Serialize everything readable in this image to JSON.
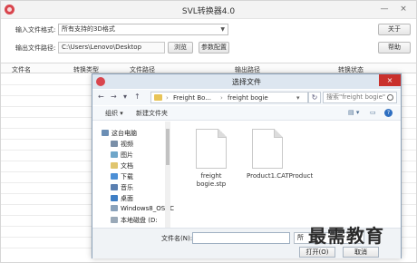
{
  "app": {
    "title": "SVL转换器4.0",
    "minimize": "—",
    "close": "×",
    "input_format_label": "输入文件格式:",
    "input_format_value": "所有支持的3D格式",
    "output_path_label": "输出文件路径:",
    "output_path_value": "C:\\Users\\Lenovo\\Desktop",
    "browse_label": "浏览",
    "params_label": "参数配置",
    "about_label": "关于",
    "help_label": "帮助",
    "columns": [
      "文件名",
      "转换类型",
      "文件路径",
      "输出路径",
      "转换状态"
    ]
  },
  "dialog": {
    "title": "选择文件",
    "close": "×",
    "breadcrumbs": [
      "Freight Bo...",
      "freight bogie"
    ],
    "search_placeholder": "搜索\"freight bogie\"",
    "organize_label": "组织 ▾",
    "new_folder_label": "新建文件夹",
    "nav_items": [
      {
        "label": "这台电脑",
        "icon": "computer-icon",
        "color": "#6c8fb5"
      },
      {
        "label": "视频",
        "icon": "video-icon",
        "color": "#7a8fa8"
      },
      {
        "label": "图片",
        "icon": "pictures-icon",
        "color": "#6fa6c9"
      },
      {
        "label": "文档",
        "icon": "documents-icon",
        "color": "#e0c56e"
      },
      {
        "label": "下载",
        "icon": "downloads-icon",
        "color": "#4c8fd6"
      },
      {
        "label": "音乐",
        "icon": "music-icon",
        "color": "#5a7fb0"
      },
      {
        "label": "桌面",
        "icon": "desktop-icon",
        "color": "#3f7fc5"
      },
      {
        "label": "Windows8_OS (C",
        "icon": "drive-icon",
        "color": "#8aa2bb"
      },
      {
        "label": "本地磁盘 (D:",
        "icon": "drive-icon",
        "color": "#9aa9b8"
      }
    ],
    "files": [
      {
        "name": "freight bogie.stp"
      },
      {
        "name": "Product1.CATProduct"
      }
    ],
    "filename_label": "文件名(N):",
    "filetype_value": "所",
    "open_label": "打开(O)",
    "cancel_label": "取消"
  },
  "watermark": "最需教育"
}
